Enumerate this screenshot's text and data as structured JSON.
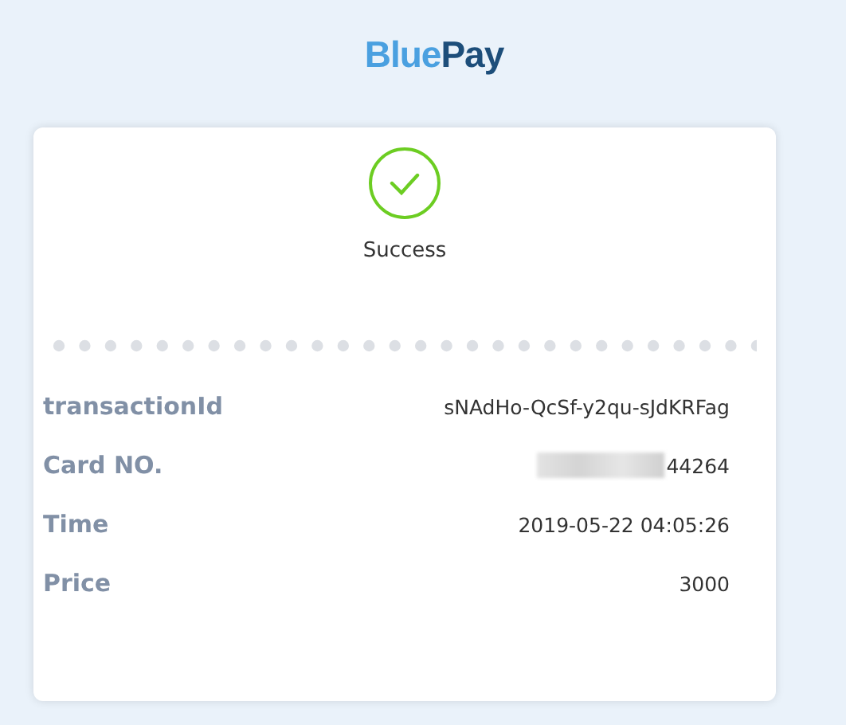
{
  "logo": {
    "parts": [
      {
        "text": "Blue",
        "color": "#4aa0e0"
      },
      {
        "text": "Pay",
        "color": "#1d4e7a"
      }
    ]
  },
  "status": {
    "kind": "success",
    "label": "Success"
  },
  "details": [
    {
      "label": "transactionId",
      "value": "sNAdHo-QcSf-y2qu-sJdKRFag",
      "redacted": false
    },
    {
      "label": "Card NO.",
      "value": "44264",
      "redacted": true
    },
    {
      "label": "Time",
      "value": "2019-05-22 04:05:26",
      "redacted": false
    },
    {
      "label": "Price",
      "value": "3000",
      "redacted": false
    }
  ]
}
